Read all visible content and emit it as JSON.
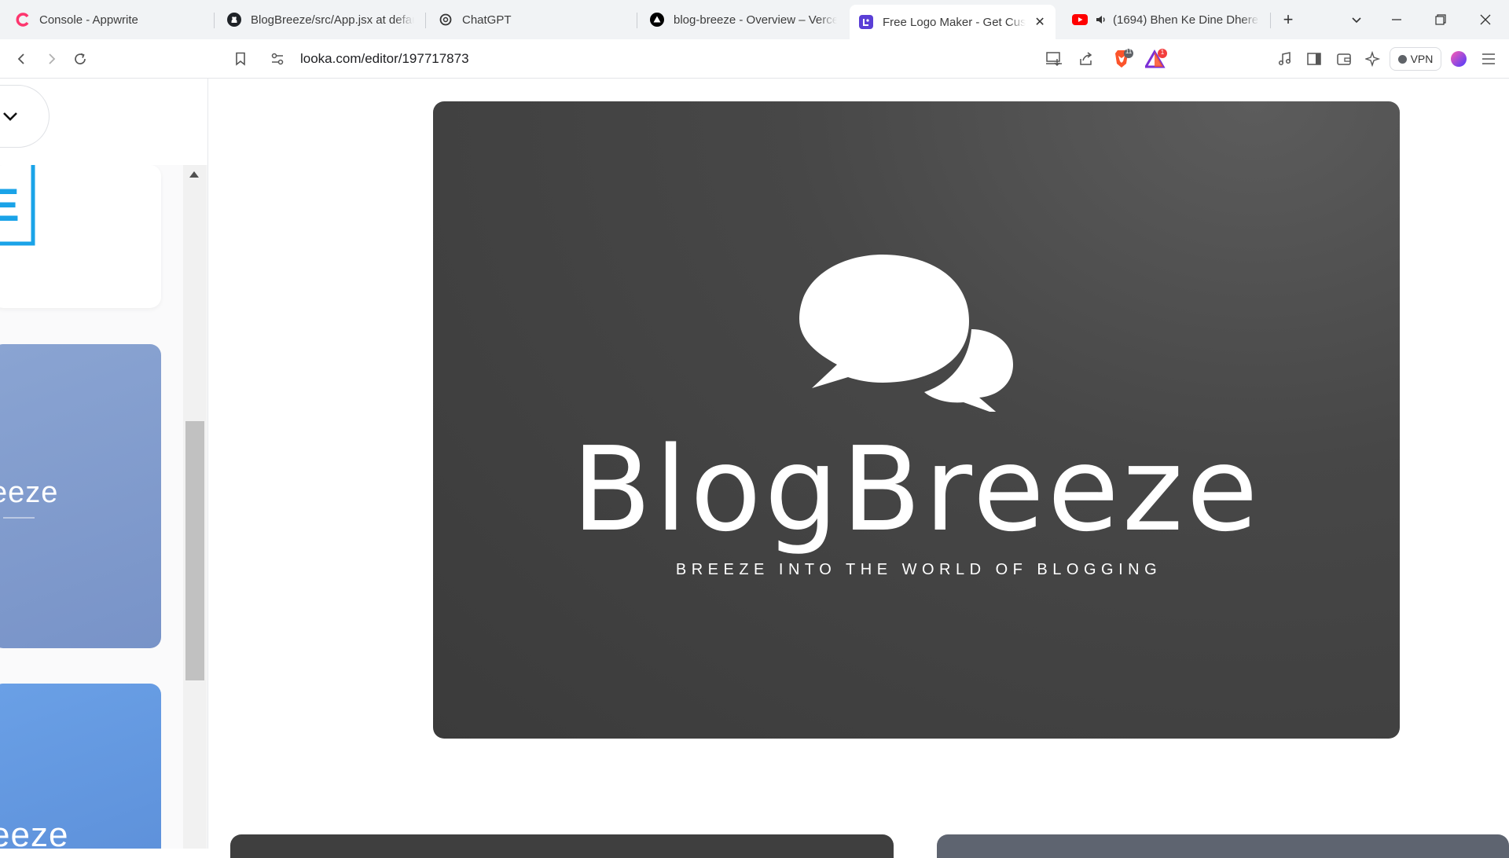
{
  "browser": {
    "tabs": [
      {
        "title": "Console - Appwrite",
        "icon": "appwrite-icon",
        "active": false
      },
      {
        "title": "BlogBreeze/src/App.jsx at default",
        "icon": "github-icon",
        "active": false
      },
      {
        "title": "ChatGPT",
        "icon": "chatgpt-icon",
        "active": false
      },
      {
        "title": "blog-breeze - Overview – Vercel",
        "icon": "vercel-icon",
        "active": false
      },
      {
        "title": "Free Logo Maker - Get Custom",
        "icon": "looka-icon",
        "active": true
      },
      {
        "title": "(1694) Bhen Ke Dine Dhere",
        "icon": "youtube-icon",
        "active": false
      }
    ],
    "url": "looka.com/editor/197717873",
    "vpn_label": "VPN",
    "brave_badge": "11",
    "rewards_badge": "1"
  },
  "sidebar": {
    "card1_letter": "E",
    "card2_word": "eeze",
    "card3_word": "eeze"
  },
  "logo": {
    "name": "BlogBreeze",
    "tagline": "BREEZE INTO THE WORLD OF BLOGGING",
    "colors": {
      "background": "#404040",
      "foreground": "#ffffff"
    }
  }
}
